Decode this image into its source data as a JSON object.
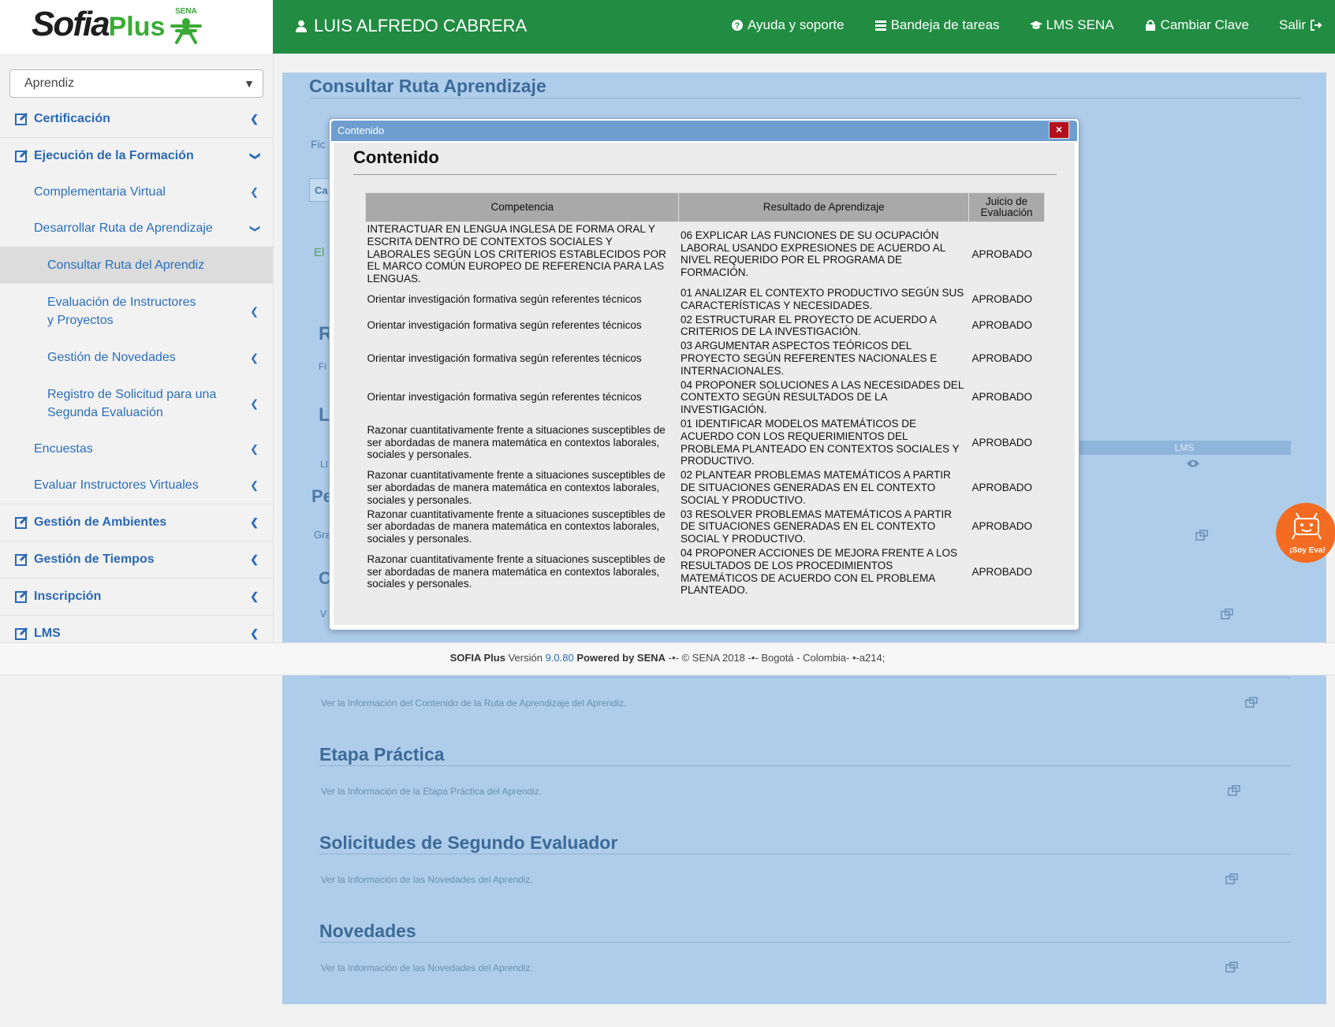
{
  "header": {
    "brand_main": "Sofia",
    "brand_plus": "Plus",
    "brand_sena": "SENA",
    "user_name": "LUIS ALFREDO CABRERA",
    "nav": [
      {
        "label": "Ayuda y soporte",
        "icon": "help-icon"
      },
      {
        "label": "Bandeja de tareas",
        "icon": "tray-icon"
      },
      {
        "label": "LMS SENA",
        "icon": "graduation-cap-icon"
      },
      {
        "label": "Cambiar Clave",
        "icon": "lock-icon"
      },
      {
        "label": "Salir",
        "icon": "sign-out-icon"
      }
    ]
  },
  "sidebar": {
    "role": "Aprendiz",
    "items": [
      {
        "label": "Certificación"
      },
      {
        "label": "Ejecución de la Formación"
      },
      {
        "label": "Complementaria Virtual"
      },
      {
        "label": "Desarrollar Ruta de Aprendizaje"
      },
      {
        "label": "Consultar Ruta del Aprendiz"
      },
      {
        "label": "Evaluación de Instructores y Proyectos"
      },
      {
        "label": "Gestión de Novedades"
      },
      {
        "label": "Registro de Solicitud para una Segunda Evaluación"
      },
      {
        "label": "Encuestas"
      },
      {
        "label": "Evaluar Instructores Virtuales"
      },
      {
        "label": "Gestión de Ambientes"
      },
      {
        "label": "Gestión de Tiempos"
      },
      {
        "label": "Inscripción"
      },
      {
        "label": "LMS"
      }
    ]
  },
  "main": {
    "title": "Consultar Ruta Aprendizaje",
    "ghost": {
      "fic": "Fic",
      "ca": "Ca",
      "el": "El",
      "r": "R",
      "fi": "Fi",
      "l": "L",
      "li": "LI",
      "pe": "Pe",
      "gra": "Gra",
      "c": "C",
      "v": "V",
      "lms": "LMS"
    },
    "sections": [
      {
        "title": "",
        "desc": "Ver la Información del Contenido de la Ruta de Aprendizaje del Aprendiz."
      },
      {
        "title": "Etapa Práctica",
        "desc": "Ver la Información de la Etapa Práctica del Aprendiz."
      },
      {
        "title": "Solicitudes de Segundo Evaluador",
        "desc": "Ver la Información de las Novedades del Aprendiz."
      },
      {
        "title": "Novedades",
        "desc": "Ver la Información de las Novedades del Aprendiz."
      }
    ]
  },
  "footer": {
    "app": "SOFIA Plus",
    "version_label": "Versión",
    "version": "9.0.80",
    "powered": "Powered by SENA",
    "rest": "-•- © SENA 2018 -•- Bogotá - Colombia- •-a214;"
  },
  "robot": {
    "label": "¡Soy Eva!"
  },
  "modal": {
    "header": "Contenido",
    "close": "×",
    "title": "Contenido",
    "columns": [
      "Competencia",
      "Resultado de Aprendizaje",
      "Juicio de Evaluación"
    ],
    "rows": [
      {
        "competencia": "INTERACTUAR EN LENGUA INGLESA DE FORMA ORAL Y ESCRITA DENTRO DE CONTEXTOS SOCIALES Y LABORALES SEGÚN LOS CRITERIOS ESTABLECIDOS POR EL MARCO COMÚN EUROPEO DE REFERENCIA PARA LAS LENGUAS.",
        "resultado": "06 EXPLICAR LAS FUNCIONES DE SU OCUPACIÓN LABORAL USANDO EXPRESIONES DE ACUERDO AL NIVEL REQUERIDO POR EL PROGRAMA DE FORMACIÓN.",
        "juicio": "APROBADO"
      },
      {
        "competencia": "Orientar investigación formativa según referentes técnicos",
        "resultado": "01 ANALIZAR EL CONTEXTO PRODUCTIVO SEGÚN SUS CARACTERÍSTICAS Y NECESIDADES.",
        "juicio": "APROBADO"
      },
      {
        "competencia": "Orientar investigación formativa según referentes técnicos",
        "resultado": "02 ESTRUCTURAR EL PROYECTO DE ACUERDO A CRITERIOS DE LA INVESTIGACIÓN.",
        "juicio": "APROBADO"
      },
      {
        "competencia": "Orientar investigación formativa según referentes técnicos",
        "resultado": "03 ARGUMENTAR ASPECTOS TEÓRICOS DEL PROYECTO SEGÚN REFERENTES NACIONALES E INTERNACIONALES.",
        "juicio": "APROBADO"
      },
      {
        "competencia": "Orientar investigación formativa según referentes técnicos",
        "resultado": "04 PROPONER SOLUCIONES A LAS NECESIDADES DEL CONTEXTO SEGÚN RESULTADOS DE LA INVESTIGACIÓN.",
        "juicio": "APROBADO"
      },
      {
        "competencia": "Razonar cuantitativamente frente a situaciones susceptibles de ser abordadas de manera matemática en contextos laborales, sociales y personales.",
        "resultado": "01 IDENTIFICAR MODELOS MATEMÁTICOS DE ACUERDO CON LOS REQUERIMIENTOS DEL PROBLEMA PLANTEADO EN CONTEXTOS SOCIALES Y PRODUCTIVO.",
        "juicio": "APROBADO"
      },
      {
        "competencia": "Razonar cuantitativamente frente a situaciones susceptibles de ser abordadas de manera matemática en contextos laborales, sociales y personales.",
        "resultado": "02 PLANTEAR PROBLEMAS MATEMÁTICOS A PARTIR DE SITUACIONES GENERADAS EN EL CONTEXTO SOCIAL Y PRODUCTIVO.",
        "juicio": "APROBADO"
      },
      {
        "competencia": "Razonar cuantitativamente frente a situaciones susceptibles de ser abordadas de manera matemática en contextos laborales, sociales y personales.",
        "resultado": "03 RESOLVER PROBLEMAS MATEMÁTICOS A PARTIR DE SITUACIONES GENERADAS EN EL CONTEXTO SOCIAL Y PRODUCTIVO.",
        "juicio": "APROBADO"
      },
      {
        "competencia": "Razonar cuantitativamente frente a situaciones susceptibles de ser abordadas de manera matemática en contextos laborales, sociales y personales.",
        "resultado": "04 PROPONER ACCIONES DE MEJORA FRENTE A LOS RESULTADOS DE LOS PROCEDIMIENTOS MATEMÁTICOS DE ACUERDO CON EL PROBLEMA PLANTEADO.",
        "juicio": "APROBADO"
      }
    ]
  }
}
